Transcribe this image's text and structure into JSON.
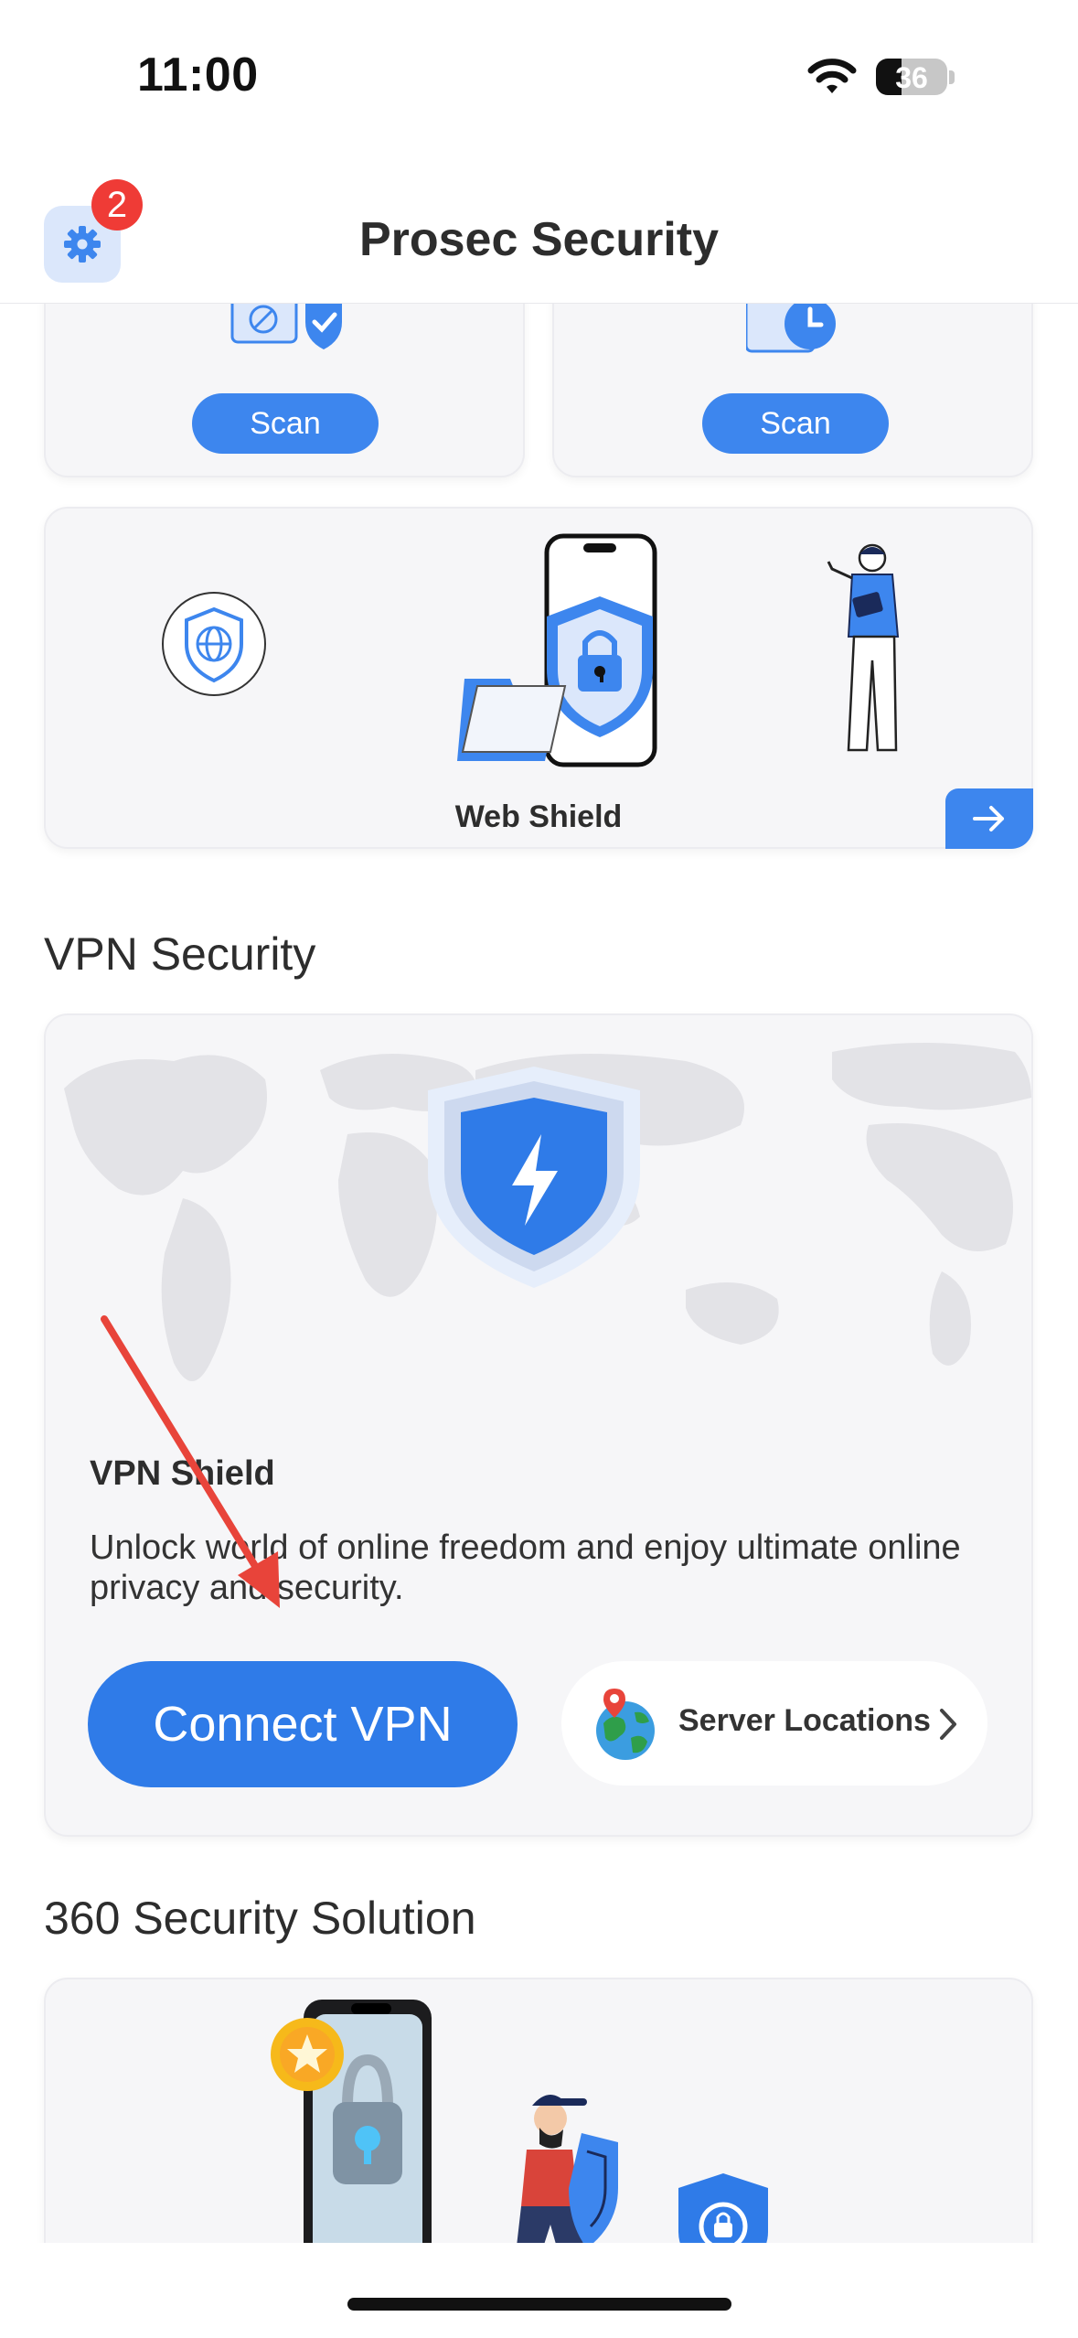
{
  "status_bar": {
    "time": "11:00",
    "battery": "36",
    "battery_level": 0.36
  },
  "header": {
    "title": "Prosec Security",
    "notification_count": "2"
  },
  "scan_cards": [
    {
      "button_label": "Scan",
      "icon": "device-shield-icon"
    },
    {
      "button_label": "Scan",
      "icon": "clock-icon"
    }
  ],
  "web_shield": {
    "label": "Web Shield",
    "arrow": "arrow-right-icon"
  },
  "vpn_section": {
    "title": "VPN Security",
    "card_title": "VPN Shield",
    "description": "Unlock world of online freedom and enjoy ultimate online privacy and security.",
    "connect_label": "Connect VPN",
    "server_label": "Server Locations"
  },
  "security_section": {
    "title": "360 Security Solution"
  },
  "colors": {
    "accent": "#3d86ee",
    "badge": "#ef3b36",
    "annotation_arrow": "#e8443a"
  }
}
